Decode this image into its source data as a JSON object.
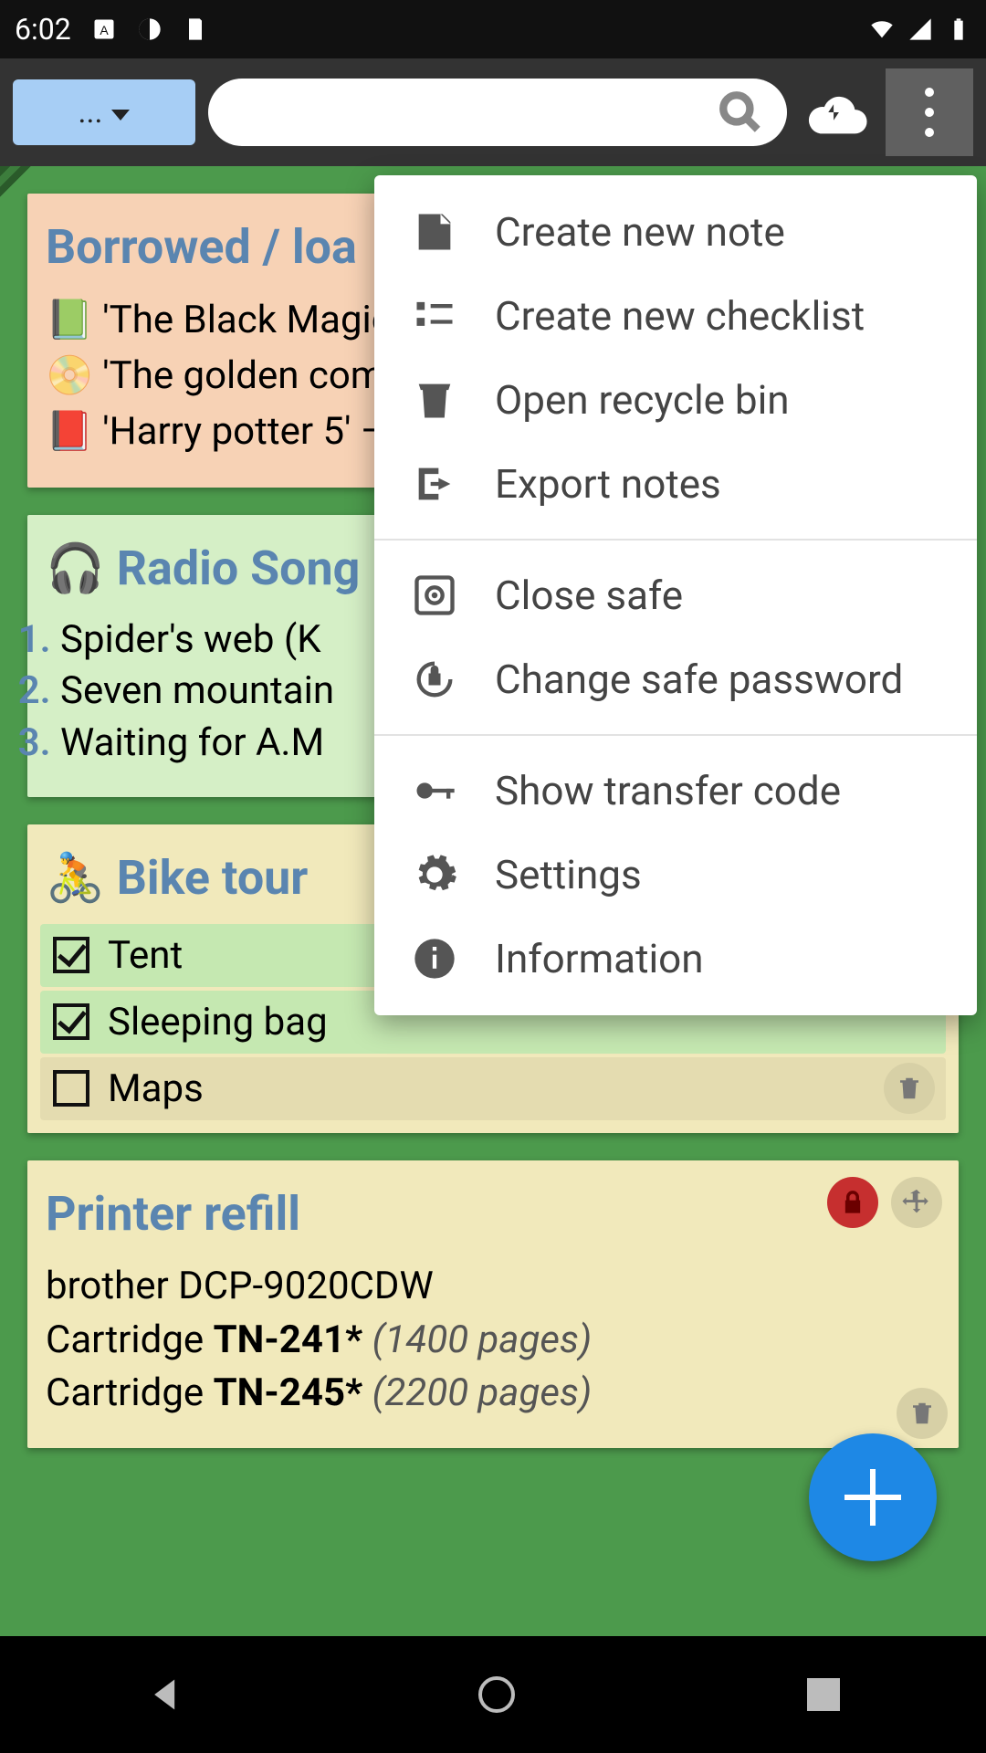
{
  "status": {
    "time": "6:02"
  },
  "appbar": {
    "category_label": "...",
    "search_value": ""
  },
  "notes": {
    "borrowed": {
      "title": "Borrowed / loa",
      "lines": [
        {
          "emoji": "📗",
          "text": "'The Black Magic"
        },
        {
          "emoji": "📀",
          "text": "'The golden com"
        },
        {
          "emoji": "📕",
          "text": "'Harry potter 5' –"
        }
      ]
    },
    "radio": {
      "title_emoji": "🎧",
      "title": "Radio Song",
      "songs": [
        "Spider's web (K",
        "Seven mountain",
        "Waiting for A.M"
      ]
    },
    "bike": {
      "title_emoji": "🚴",
      "title": "Bike tour",
      "items": [
        {
          "label": "Tent",
          "checked": true
        },
        {
          "label": "Sleeping bag",
          "checked": true
        },
        {
          "label": "Maps",
          "checked": false
        }
      ]
    },
    "printer": {
      "title": "Printer refill",
      "model": "brother DCP-9020CDW",
      "rows": [
        {
          "prefix": "Cartridge ",
          "code": "TN-241*",
          "pages": "(1400 pages)"
        },
        {
          "prefix": "Cartridge ",
          "code": "TN-245*",
          "pages": "(2200 pages)"
        }
      ]
    }
  },
  "menu": {
    "g1": [
      {
        "icon": "note",
        "label": "Create new note"
      },
      {
        "icon": "checklist",
        "label": "Create new checklist"
      },
      {
        "icon": "trash",
        "label": "Open recycle bin"
      },
      {
        "icon": "export",
        "label": "Export notes"
      }
    ],
    "g2": [
      {
        "icon": "safe",
        "label": "Close safe"
      },
      {
        "icon": "password",
        "label": "Change safe password"
      }
    ],
    "g3": [
      {
        "icon": "key",
        "label": "Show transfer code"
      },
      {
        "icon": "gear",
        "label": "Settings"
      },
      {
        "icon": "info",
        "label": "Information"
      }
    ]
  }
}
